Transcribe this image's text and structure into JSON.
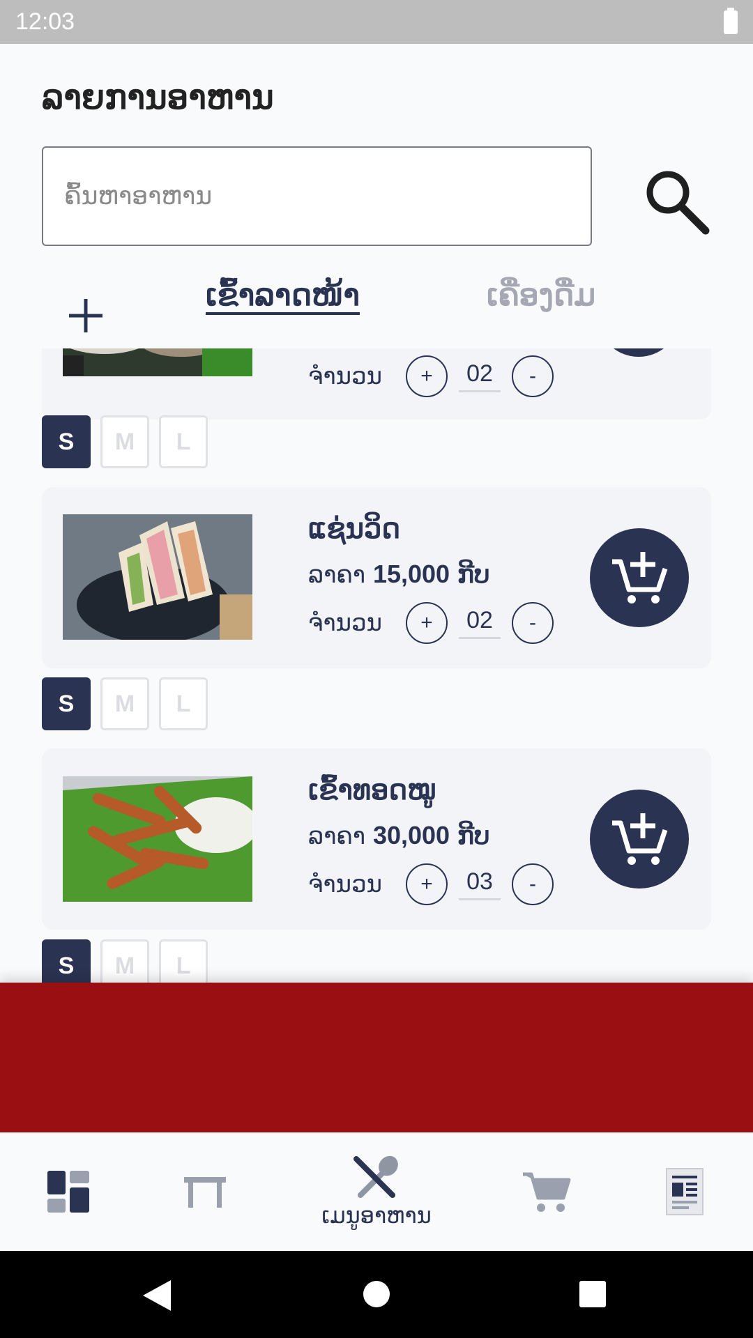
{
  "status_bar": {
    "time": "12:03"
  },
  "header": {
    "title": "ລາຍການອາຫານ",
    "search_placeholder": "ຄົ້ນຫາອາຫານ"
  },
  "tabs": [
    {
      "label": "ເຂົ້າລາດໜ້າ",
      "active": true
    },
    {
      "label": "ເຄື່ອງດື່ມ",
      "active": false
    }
  ],
  "labels": {
    "price_prefix": "ລາຄາ",
    "currency": "ກີບ",
    "qty_label": "ຈຳນວນ",
    "plus": "+",
    "minus": "-"
  },
  "items": [
    {
      "name": "",
      "price": "",
      "qty": "02",
      "size": "S",
      "partial": true
    },
    {
      "name": "ແຊ່ນວິດ",
      "price": "15,000",
      "qty": "02",
      "size": "S"
    },
    {
      "name": "ເຂົ້າທອດໝູ",
      "price": "30,000",
      "qty": "03",
      "size": "S"
    }
  ],
  "sizes": [
    "S",
    "M",
    "L"
  ],
  "bottom_nav": [
    {
      "icon": "dashboard-icon",
      "label": ""
    },
    {
      "icon": "table-icon",
      "label": ""
    },
    {
      "icon": "utensils-icon",
      "label": "ເມນູອາຫານ",
      "active": true
    },
    {
      "icon": "cart-icon",
      "label": ""
    },
    {
      "icon": "receipt-icon",
      "label": ""
    }
  ],
  "colors": {
    "primary": "#2b3352",
    "banner": "#9a1012",
    "inactive_tab": "#a5a7b3",
    "card_bg": "#f2f4f7"
  }
}
